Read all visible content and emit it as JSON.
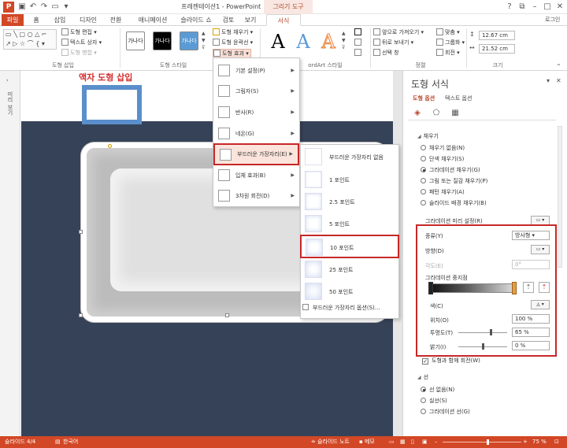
{
  "titlebar": {
    "document_title": "프레젠테이션1 - PowerPoint",
    "context_tab_title": "그리기 도구",
    "login": "로그인"
  },
  "tabs": [
    "파일",
    "홈",
    "삽입",
    "디자인",
    "전환",
    "애니메이션",
    "슬라이드 쇼",
    "검토",
    "보기",
    "서식"
  ],
  "ribbon": {
    "insert_shapes": {
      "label": "도형 삽입",
      "items": [
        "도형 편집 ▾",
        "텍스트 상자 ▾",
        "도형 병합 ▾"
      ]
    },
    "shape_styles": {
      "label": "도형 스타일",
      "swatches": [
        "가나다",
        "가나다",
        "가나다"
      ],
      "items": [
        "도형 채우기 ▾",
        "도형 윤곽선 ▾",
        "도형 효과 ▾"
      ]
    },
    "wordart": {
      "label": "WordArt 스타일",
      "label_visible": "ordArt 스타일",
      "letters": [
        "A",
        "A",
        "A"
      ]
    },
    "arrange": {
      "label": "정렬",
      "items": [
        "앞으로 가져오기 ▾",
        "뒤로 보내기 ▾",
        "선택 창"
      ],
      "right_items": [
        "맞춤 ▾",
        "그룹화 ▾",
        "회전 ▾"
      ]
    },
    "size": {
      "label": "크기",
      "height": "12.67 cm",
      "width": "21.52 cm"
    }
  },
  "slide": {
    "annotation": "액자 도형 삽입"
  },
  "effects_menu": {
    "items": [
      {
        "label": "기본 설정(P)"
      },
      {
        "label": "그림자(S)"
      },
      {
        "label": "반사(R)"
      },
      {
        "label": "네온(G)"
      },
      {
        "label": "부드러운 가장자리(E)"
      },
      {
        "label": "입체 효과(B)"
      },
      {
        "label": "3차원 회전(D)"
      }
    ],
    "highlighted": "부드러운 가장자리(E)"
  },
  "soft_edges_submenu": {
    "items": [
      "부드러운 가장자리 없음",
      "1 포인트",
      "2.5 포인트",
      "5 포인트",
      "10 포인트",
      "25 포인트",
      "50 포인트"
    ],
    "selected": "10 포인트",
    "options_link": "부드러운 가장자리 옵션(S)..."
  },
  "format_pane": {
    "title": "도형 서식",
    "tabs": [
      "도형 옵션",
      "텍스트 옵션"
    ],
    "fill_section": "채우기",
    "fill_options": [
      "채우기 없음(N)",
      "단색 채우기(S)",
      "그라데이션 채우기(G)",
      "그림 또는 질감 채우기(P)",
      "패턴 채우기(A)",
      "슬라이드 배경 채우기(B)"
    ],
    "fill_selected": "그라데이션 채우기(G)",
    "preset_label": "그라데이션 미리 설정(R)",
    "type_label": "종류(Y)",
    "type_value": "방사형",
    "direction_label": "방향(D)",
    "angle_label": "각도(E)",
    "angle_value": "0°",
    "stops_label": "그라데이션 중지점",
    "color_label": "색(C)",
    "position_label": "위치(O)",
    "position_value": "100 %",
    "transparency_label": "투명도(T)",
    "transparency_value": "65 %",
    "brightness_label": "밝기(I)",
    "brightness_value": "0 %",
    "rotate_with_shape": "도형과 함께 회전(W)",
    "line_section": "선",
    "line_options": [
      "선 없음(N)",
      "실선(S)",
      "그라데이션 선(G)"
    ],
    "line_selected": "선 없음(N)"
  },
  "left_strip": "미리 보기",
  "statusbar": {
    "slide_info": "슬라이드 4/4",
    "language": "한국어",
    "notes": "슬라이드 노트",
    "comments": "메모",
    "zoom": "75 %"
  }
}
